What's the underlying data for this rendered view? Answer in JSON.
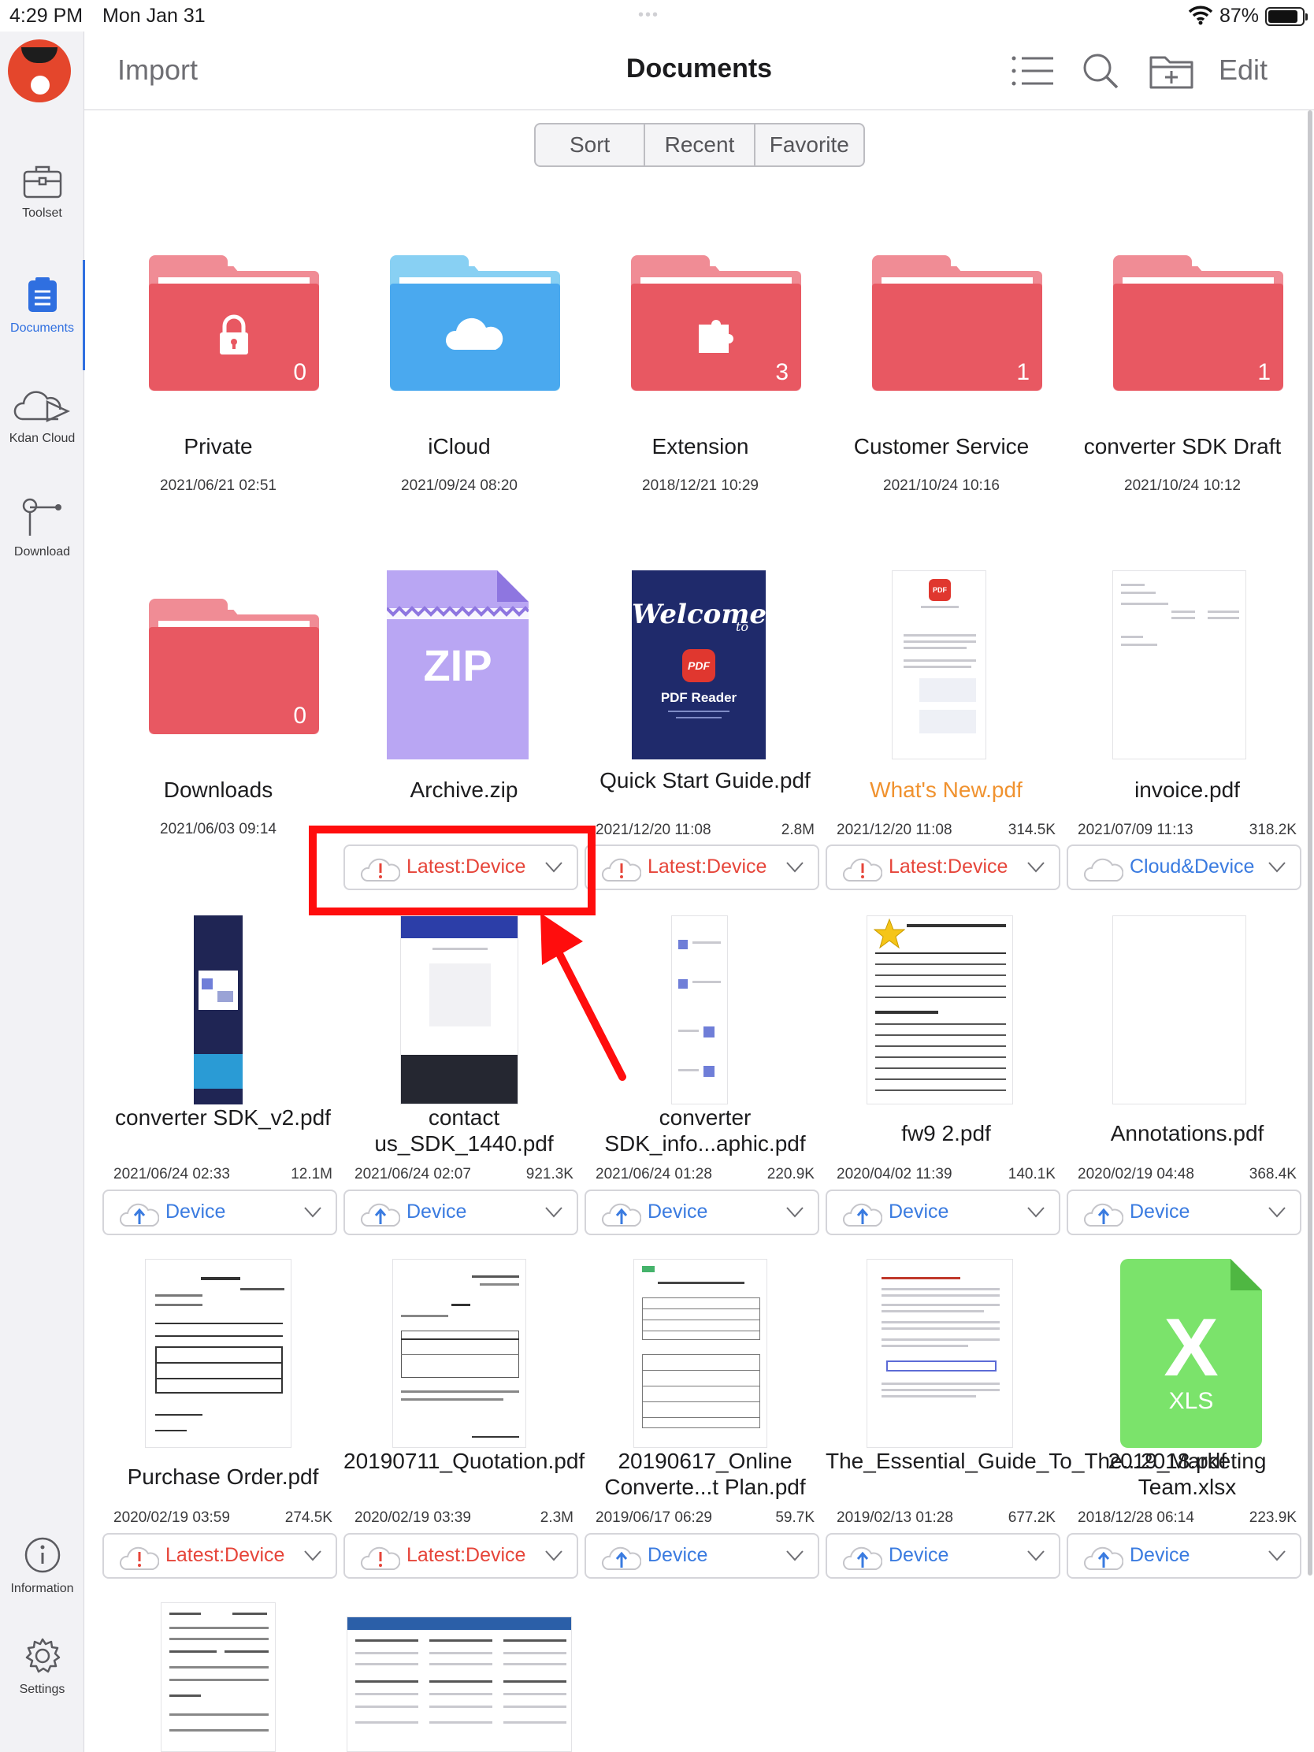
{
  "status_bar": {
    "time": "4:29 PM",
    "date": "Mon Jan 31",
    "battery": "87%"
  },
  "sidebar": {
    "items": [
      {
        "label": "Toolset"
      },
      {
        "label": "Documents"
      },
      {
        "label": "Kdan Cloud"
      },
      {
        "label": "Download"
      },
      {
        "label": "Information"
      },
      {
        "label": "Settings"
      }
    ]
  },
  "header": {
    "import": "Import",
    "title": "Documents",
    "edit": "Edit"
  },
  "segments": [
    "Sort",
    "Recent",
    "Favorite"
  ],
  "items": [
    {
      "name": "Private",
      "date": "2021/06/21 02:51",
      "count": "0"
    },
    {
      "name": "iCloud",
      "date": "2021/09/24 08:20"
    },
    {
      "name": "Extension",
      "date": "2018/12/21 10:29",
      "count": "3"
    },
    {
      "name": "Customer Service",
      "date": "2021/10/24 10:16",
      "count": "1"
    },
    {
      "name": "converter SDK Draft",
      "date": "2021/10/24 10:12",
      "count": "1"
    },
    {
      "name": "Downloads",
      "date": "2021/06/03 09:14",
      "count": "0"
    },
    {
      "name": "Archive.zip",
      "status": "Latest:Device",
      "thumb_text": "ZIP"
    },
    {
      "name": "Quick Start Guide.pdf",
      "date": "2021/12/20 11:08",
      "size": "2.8M",
      "status": "Latest:Device",
      "thumb_title": "Welcome",
      "thumb_sub": "to",
      "thumb_badge": "PDF",
      "thumb_caption": "PDF Reader"
    },
    {
      "name": "What's New.pdf",
      "date": "2021/12/20 11:08",
      "size": "314.5K",
      "status": "Latest:Device",
      "thumb_badge": "PDF"
    },
    {
      "name": "invoice.pdf",
      "date": "2021/07/09 11:13",
      "size": "318.2K",
      "status": "Cloud&Device"
    },
    {
      "name": "converter SDK_v2.pdf",
      "date": "2021/06/24 02:33",
      "size": "12.1M",
      "status": "Device"
    },
    {
      "name": "contact us_SDK_1440.pdf",
      "date": "2021/06/24 02:07",
      "size": "921.3K",
      "status": "Device"
    },
    {
      "name": "converter SDK_info...aphic.pdf",
      "date": "2021/06/24 01:28",
      "size": "220.9K",
      "status": "Device"
    },
    {
      "name": "fw9 2.pdf",
      "date": "2020/04/02 11:39",
      "size": "140.1K",
      "status": "Device"
    },
    {
      "name": "Annotations.pdf",
      "date": "2020/02/19 04:48",
      "size": "368.4K",
      "status": "Device"
    },
    {
      "name": "Purchase Order.pdf",
      "date": "2020/02/19 03:59",
      "size": "274.5K",
      "status": "Latest:Device"
    },
    {
      "name": "20190711_Quotation.pdf",
      "date": "2020/02/19 03:39",
      "size": "2.3M",
      "status": "Latest:Device"
    },
    {
      "name": "20190617_Online Converte...t Plan.pdf",
      "date": "2019/06/17 06:29",
      "size": "59.7K",
      "status": "Device"
    },
    {
      "name": "The_Essential_Guide_To_The...2018.pdf",
      "date": "2019/02/13 01:28",
      "size": "677.2K",
      "status": "Device"
    },
    {
      "name": "2019_Marketing Team.xlsx",
      "date": "2018/12/28 06:14",
      "size": "223.9K",
      "status": "Device",
      "thumb_text": "X",
      "thumb_sub": "XLS"
    }
  ],
  "colors": {
    "accent": "#2f6fe0",
    "folder_red": "#e85862",
    "folder_blue": "#4aa9ef",
    "highlight": "#ff0d0d",
    "xls_green": "#7be36b"
  }
}
